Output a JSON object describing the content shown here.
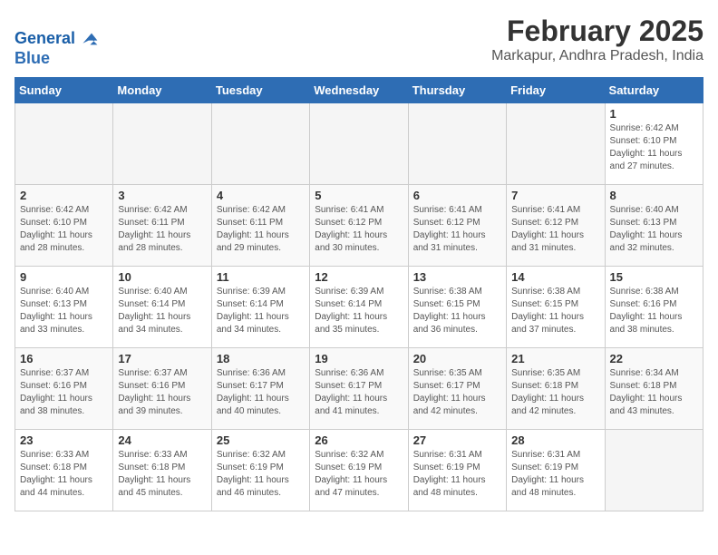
{
  "logo": {
    "line1": "General",
    "line2": "Blue"
  },
  "title": "February 2025",
  "subtitle": "Markapur, Andhra Pradesh, India",
  "days_of_week": [
    "Sunday",
    "Monday",
    "Tuesday",
    "Wednesday",
    "Thursday",
    "Friday",
    "Saturday"
  ],
  "weeks": [
    [
      {
        "day": "",
        "info": ""
      },
      {
        "day": "",
        "info": ""
      },
      {
        "day": "",
        "info": ""
      },
      {
        "day": "",
        "info": ""
      },
      {
        "day": "",
        "info": ""
      },
      {
        "day": "",
        "info": ""
      },
      {
        "day": "1",
        "info": "Sunrise: 6:42 AM\nSunset: 6:10 PM\nDaylight: 11 hours\nand 27 minutes."
      }
    ],
    [
      {
        "day": "2",
        "info": "Sunrise: 6:42 AM\nSunset: 6:10 PM\nDaylight: 11 hours\nand 28 minutes."
      },
      {
        "day": "3",
        "info": "Sunrise: 6:42 AM\nSunset: 6:11 PM\nDaylight: 11 hours\nand 28 minutes."
      },
      {
        "day": "4",
        "info": "Sunrise: 6:42 AM\nSunset: 6:11 PM\nDaylight: 11 hours\nand 29 minutes."
      },
      {
        "day": "5",
        "info": "Sunrise: 6:41 AM\nSunset: 6:12 PM\nDaylight: 11 hours\nand 30 minutes."
      },
      {
        "day": "6",
        "info": "Sunrise: 6:41 AM\nSunset: 6:12 PM\nDaylight: 11 hours\nand 31 minutes."
      },
      {
        "day": "7",
        "info": "Sunrise: 6:41 AM\nSunset: 6:12 PM\nDaylight: 11 hours\nand 31 minutes."
      },
      {
        "day": "8",
        "info": "Sunrise: 6:40 AM\nSunset: 6:13 PM\nDaylight: 11 hours\nand 32 minutes."
      }
    ],
    [
      {
        "day": "9",
        "info": "Sunrise: 6:40 AM\nSunset: 6:13 PM\nDaylight: 11 hours\nand 33 minutes."
      },
      {
        "day": "10",
        "info": "Sunrise: 6:40 AM\nSunset: 6:14 PM\nDaylight: 11 hours\nand 34 minutes."
      },
      {
        "day": "11",
        "info": "Sunrise: 6:39 AM\nSunset: 6:14 PM\nDaylight: 11 hours\nand 34 minutes."
      },
      {
        "day": "12",
        "info": "Sunrise: 6:39 AM\nSunset: 6:14 PM\nDaylight: 11 hours\nand 35 minutes."
      },
      {
        "day": "13",
        "info": "Sunrise: 6:38 AM\nSunset: 6:15 PM\nDaylight: 11 hours\nand 36 minutes."
      },
      {
        "day": "14",
        "info": "Sunrise: 6:38 AM\nSunset: 6:15 PM\nDaylight: 11 hours\nand 37 minutes."
      },
      {
        "day": "15",
        "info": "Sunrise: 6:38 AM\nSunset: 6:16 PM\nDaylight: 11 hours\nand 38 minutes."
      }
    ],
    [
      {
        "day": "16",
        "info": "Sunrise: 6:37 AM\nSunset: 6:16 PM\nDaylight: 11 hours\nand 38 minutes."
      },
      {
        "day": "17",
        "info": "Sunrise: 6:37 AM\nSunset: 6:16 PM\nDaylight: 11 hours\nand 39 minutes."
      },
      {
        "day": "18",
        "info": "Sunrise: 6:36 AM\nSunset: 6:17 PM\nDaylight: 11 hours\nand 40 minutes."
      },
      {
        "day": "19",
        "info": "Sunrise: 6:36 AM\nSunset: 6:17 PM\nDaylight: 11 hours\nand 41 minutes."
      },
      {
        "day": "20",
        "info": "Sunrise: 6:35 AM\nSunset: 6:17 PM\nDaylight: 11 hours\nand 42 minutes."
      },
      {
        "day": "21",
        "info": "Sunrise: 6:35 AM\nSunset: 6:18 PM\nDaylight: 11 hours\nand 42 minutes."
      },
      {
        "day": "22",
        "info": "Sunrise: 6:34 AM\nSunset: 6:18 PM\nDaylight: 11 hours\nand 43 minutes."
      }
    ],
    [
      {
        "day": "23",
        "info": "Sunrise: 6:33 AM\nSunset: 6:18 PM\nDaylight: 11 hours\nand 44 minutes."
      },
      {
        "day": "24",
        "info": "Sunrise: 6:33 AM\nSunset: 6:18 PM\nDaylight: 11 hours\nand 45 minutes."
      },
      {
        "day": "25",
        "info": "Sunrise: 6:32 AM\nSunset: 6:19 PM\nDaylight: 11 hours\nand 46 minutes."
      },
      {
        "day": "26",
        "info": "Sunrise: 6:32 AM\nSunset: 6:19 PM\nDaylight: 11 hours\nand 47 minutes."
      },
      {
        "day": "27",
        "info": "Sunrise: 6:31 AM\nSunset: 6:19 PM\nDaylight: 11 hours\nand 48 minutes."
      },
      {
        "day": "28",
        "info": "Sunrise: 6:31 AM\nSunset: 6:19 PM\nDaylight: 11 hours\nand 48 minutes."
      },
      {
        "day": "",
        "info": ""
      }
    ]
  ]
}
